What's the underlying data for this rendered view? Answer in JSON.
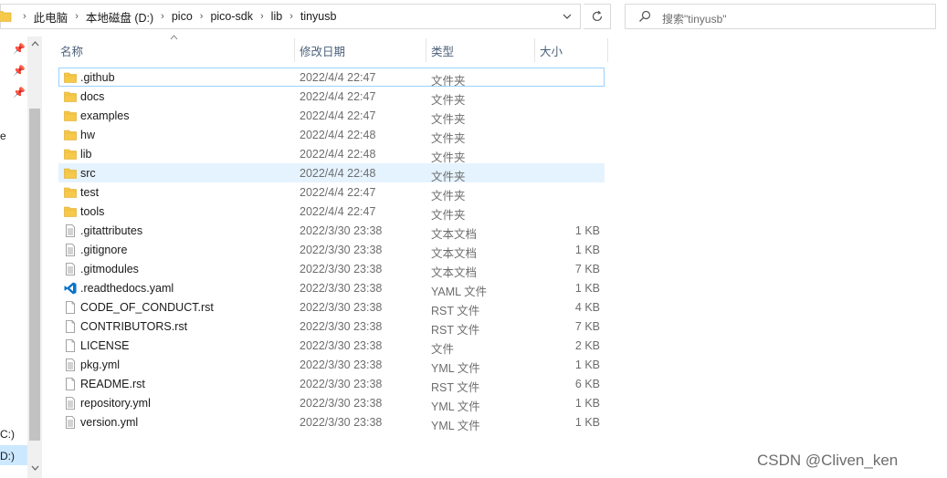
{
  "address": {
    "crumbs": [
      "此电脑",
      "本地磁盘 (D:)",
      "pico",
      "pico-sdk",
      "lib",
      "tinyusb"
    ],
    "separator": "›",
    "dropdown_icon": "chevron-down-icon",
    "refresh_icon": "refresh-icon"
  },
  "search": {
    "placeholder": "搜索\"tinyusb\""
  },
  "nav": {
    "items": [
      "e",
      "C:)",
      "D:)"
    ]
  },
  "columns": {
    "name": "名称",
    "date": "修改日期",
    "type": "类型",
    "size": "大小"
  },
  "files": [
    {
      "name": ".github",
      "date": "2022/4/4 22:47",
      "type": "文件夹",
      "size": "",
      "icon": "folder-icon"
    },
    {
      "name": "docs",
      "date": "2022/4/4 22:47",
      "type": "文件夹",
      "size": "",
      "icon": "folder-icon"
    },
    {
      "name": "examples",
      "date": "2022/4/4 22:47",
      "type": "文件夹",
      "size": "",
      "icon": "folder-icon"
    },
    {
      "name": "hw",
      "date": "2022/4/4 22:48",
      "type": "文件夹",
      "size": "",
      "icon": "folder-icon"
    },
    {
      "name": "lib",
      "date": "2022/4/4 22:48",
      "type": "文件夹",
      "size": "",
      "icon": "folder-icon"
    },
    {
      "name": "src",
      "date": "2022/4/4 22:48",
      "type": "文件夹",
      "size": "",
      "icon": "folder-icon"
    },
    {
      "name": "test",
      "date": "2022/4/4 22:47",
      "type": "文件夹",
      "size": "",
      "icon": "folder-icon"
    },
    {
      "name": "tools",
      "date": "2022/4/4 22:47",
      "type": "文件夹",
      "size": "",
      "icon": "folder-icon"
    },
    {
      "name": ".gitattributes",
      "date": "2022/3/30 23:38",
      "type": "文本文档",
      "size": "1 KB",
      "icon": "text-document-icon"
    },
    {
      "name": ".gitignore",
      "date": "2022/3/30 23:38",
      "type": "文本文档",
      "size": "1 KB",
      "icon": "text-document-icon"
    },
    {
      "name": ".gitmodules",
      "date": "2022/3/30 23:38",
      "type": "文本文档",
      "size": "7 KB",
      "icon": "text-document-icon"
    },
    {
      "name": ".readthedocs.yaml",
      "date": "2022/3/30 23:38",
      "type": "YAML 文件",
      "size": "1 KB",
      "icon": "vscode-icon"
    },
    {
      "name": "CODE_OF_CONDUCT.rst",
      "date": "2022/3/30 23:38",
      "type": "RST 文件",
      "size": "4 KB",
      "icon": "blank-file-icon"
    },
    {
      "name": "CONTRIBUTORS.rst",
      "date": "2022/3/30 23:38",
      "type": "RST 文件",
      "size": "7 KB",
      "icon": "blank-file-icon"
    },
    {
      "name": "LICENSE",
      "date": "2022/3/30 23:38",
      "type": "文件",
      "size": "2 KB",
      "icon": "blank-file-icon"
    },
    {
      "name": "pkg.yml",
      "date": "2022/3/30 23:38",
      "type": "YML 文件",
      "size": "1 KB",
      "icon": "text-document-icon"
    },
    {
      "name": "README.rst",
      "date": "2022/3/30 23:38",
      "type": "RST 文件",
      "size": "6 KB",
      "icon": "blank-file-icon"
    },
    {
      "name": "repository.yml",
      "date": "2022/3/30 23:38",
      "type": "YML 文件",
      "size": "1 KB",
      "icon": "text-document-icon"
    },
    {
      "name": "version.yml",
      "date": "2022/3/30 23:38",
      "type": "YML 文件",
      "size": "1 KB",
      "icon": "text-document-icon"
    }
  ],
  "watermark": "CSDN @Cliven_ken",
  "colors": {
    "folder": "#f6c94a",
    "selection": "#cce8ff",
    "hover": "#e5f3ff",
    "focus_border": "#99d1ff",
    "header_text": "#4c607a",
    "vscode_blue": "#0a74c9"
  }
}
